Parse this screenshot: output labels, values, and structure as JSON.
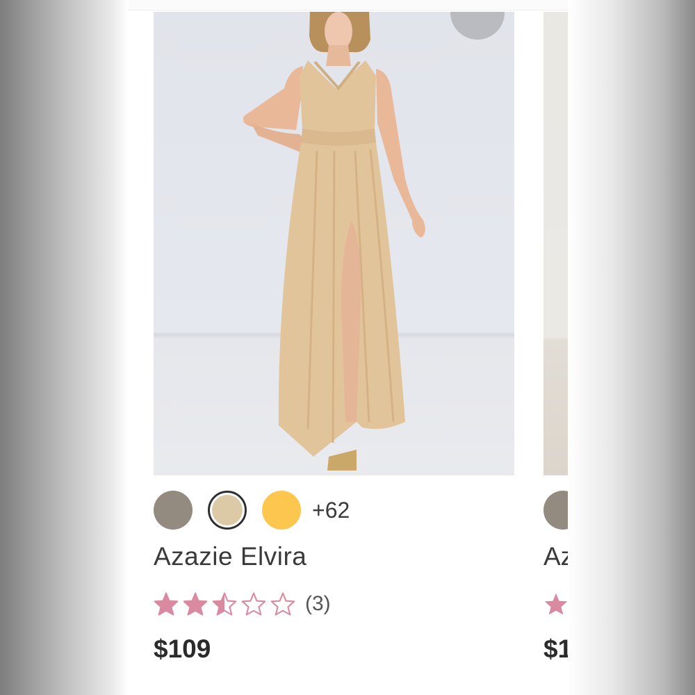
{
  "product": {
    "name": "Azazie Elvira",
    "price": "$109",
    "rating": 2.5,
    "rating_max": 5,
    "review_count": "(3)",
    "image_icon": "dress-model-photo",
    "favorite_icon": "heart-icon",
    "star_color": "#d98aa0",
    "colors": {
      "swatches": [
        "#938a80",
        "#dcc9a6",
        "#fdc64f"
      ],
      "selected_index": 1,
      "more_count": "+62"
    }
  },
  "next_product": {
    "name": "Az",
    "price": "$1",
    "swatch": "#938a80"
  }
}
